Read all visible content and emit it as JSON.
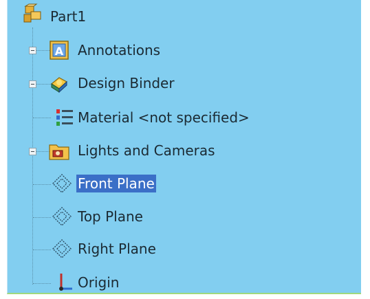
{
  "tree": {
    "root": {
      "label": "Part1",
      "icon": "part-icon"
    },
    "items": [
      {
        "label": "Annotations",
        "icon": "annotations-icon",
        "expandable": true
      },
      {
        "label": "Design Binder",
        "icon": "design-binder-icon",
        "expandable": true
      },
      {
        "label": "Material <not specified>",
        "icon": "material-icon",
        "expandable": false
      },
      {
        "label": "Lights and Cameras",
        "icon": "lights-cameras-folder-icon",
        "expandable": true
      },
      {
        "label": "Front Plane",
        "icon": "plane-icon",
        "expandable": false,
        "selected": true
      },
      {
        "label": "Top Plane",
        "icon": "plane-icon",
        "expandable": false
      },
      {
        "label": "Right Plane",
        "icon": "plane-icon",
        "expandable": false
      },
      {
        "label": "Origin",
        "icon": "origin-icon",
        "expandable": false
      }
    ]
  },
  "colors": {
    "background": "#82cef0",
    "selection": "#3b6fc7"
  }
}
